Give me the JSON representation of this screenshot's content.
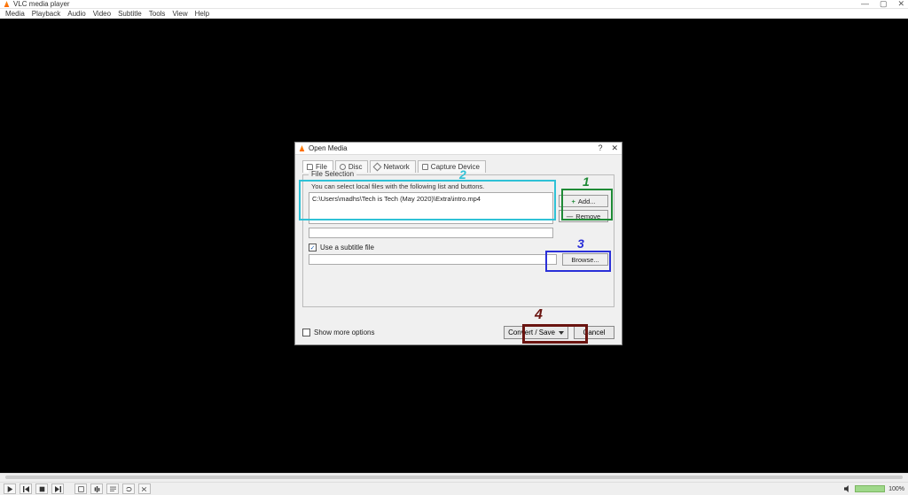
{
  "window": {
    "title": "VLC media player",
    "controls": {
      "minimize": "—",
      "maximize": "▢",
      "close": "✕"
    }
  },
  "menubar": [
    "Media",
    "Playback",
    "Audio",
    "Video",
    "Subtitle",
    "Tools",
    "View",
    "Help"
  ],
  "player": {
    "volume_label": "100%"
  },
  "dialog": {
    "title": "Open Media",
    "controls": {
      "help": "?",
      "close": "✕"
    },
    "tabs": {
      "file": "File",
      "disc": "Disc",
      "network": "Network",
      "capture": "Capture Device"
    },
    "file_section": {
      "legend": "File Selection",
      "hint": "You can select local files with the following list and buttons.",
      "selected_file": "C:\\Users\\madhs\\Tech is Tech (May 2020)\\Extra\\intro.mp4",
      "add_label": "Add...",
      "remove_label": "Remove"
    },
    "subtitle": {
      "checkbox_label": "Use a subtitle file",
      "browse_label": "Browse..."
    },
    "footer": {
      "show_more_label": "Show more options",
      "convert_label": "Convert / Save",
      "cancel_label": "Cancel"
    }
  },
  "annotations": {
    "n1": "1",
    "n2": "2",
    "n3": "3",
    "n4": "4"
  }
}
